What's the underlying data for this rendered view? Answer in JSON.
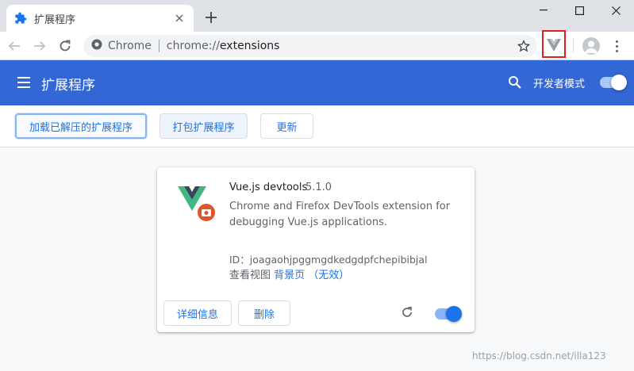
{
  "browser": {
    "tab_title": "扩展程序",
    "omnibox_site": "Chrome",
    "omnibox_scheme": "chrome://",
    "omnibox_path": "extensions"
  },
  "header": {
    "title": "扩展程序",
    "dev_mode_label": "开发者模式",
    "dev_mode_on": true
  },
  "actions": {
    "load_unpacked": "加载已解压的扩展程序",
    "pack": "打包扩展程序",
    "update": "更新"
  },
  "extension": {
    "name": "Vue.js devtools",
    "version": "5.1.0",
    "description": "Chrome and Firefox DevTools extension for debugging Vue.js applications.",
    "id_line": "ID：joagaohjpggmgdkedgdpfchepibibjal",
    "inspect_label": "查看视图",
    "inspect_link": "背景页 （无效）",
    "details_button": "详细信息",
    "remove_button": "删除",
    "enabled": true
  },
  "watermark": "https://blog.csdn.net/illa123",
  "colors": {
    "header_bg": "#3367d6",
    "accent": "#1a73e8",
    "highlight_box": "#e02020",
    "vue_green": "#41b883",
    "vue_dark": "#34495e",
    "devtools_badge": "#e0542c"
  }
}
